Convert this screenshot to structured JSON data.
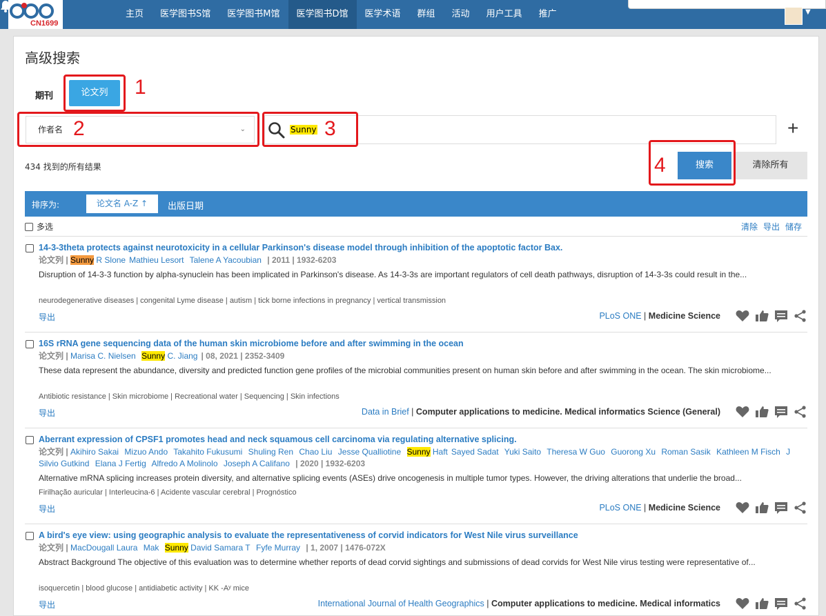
{
  "nav": {
    "logo_text": "CN1699",
    "menu": [
      "主页",
      "医学图书S馆",
      "医学图书M馆",
      "医学图书D馆",
      "医学术语",
      "群组",
      "活动",
      "用户工具",
      "推广"
    ],
    "active_index": 3
  },
  "page": {
    "title": "高级搜索",
    "tab_journal": "期刊",
    "tab_paper": "论文列",
    "field_select": "作者名",
    "query": "Sunny",
    "search_btn": "搜索",
    "clear_btn": "清除所有",
    "result_count": "434 找到的所有结果",
    "sort_label": "排序为:",
    "sort_title": "论文名 A-Z",
    "sort_date": "出版日期",
    "multi_select": "多选",
    "tools": {
      "clear": "清除",
      "export": "导出",
      "save": "储存"
    }
  },
  "annotations": [
    "1",
    "2",
    "3",
    "4"
  ],
  "results": [
    {
      "title": "14-3-3theta protects against neurotoxicity in a cellular Parkinson's disease model through inhibition of the apoptotic factor Bax.",
      "kind": "论文列",
      "hl_style": "orange",
      "authors_pre": [],
      "hl_name": "Sunny",
      "hl_suffix": "R Slone",
      "authors_post": [
        "Mathieu Lesort",
        "Talene A Yacoubian"
      ],
      "meta": "2011 | 1932-6203",
      "abstract": "Disruption of 14-3-3 function by alpha-synuclein has been implicated in Parkinson's disease. As 14-3-3s are important regulators of cell death pathways, disruption of 14-3-3s could result in the...",
      "keywords": "neurodegenerative diseases | congenital Lyme disease | autism | tick borne infections in pregnancy | vertical transmission",
      "export": "导出",
      "journal": "PLoS ONE",
      "categories": "Medicine  Science"
    },
    {
      "title": "16S rRNA gene sequencing data of the human skin microbiome before and after swimming in the ocean",
      "kind": "论文列",
      "hl_style": "yellow",
      "authors_pre": [
        "Marisa C. Nielsen"
      ],
      "hl_name": "Sunny",
      "hl_suffix": "C. Jiang",
      "authors_post": [],
      "meta": "08, 2021 | 2352-3409",
      "abstract": "These data represent the abundance, diversity and predicted function gene profiles of the microbial communities present on human skin before and after swimming in the ocean. The skin microbiome...",
      "keywords": "Antibiotic resistance | Skin microbiome | Recreational water | Sequencing | Skin infections",
      "export": "导出",
      "journal": "Data in Brief",
      "categories": "Computer applications to medicine. Medical informatics  Science (General)"
    },
    {
      "title": "Aberrant expression of CPSF1 promotes head and neck squamous cell carcinoma via regulating alternative splicing.",
      "kind": "论文列",
      "hl_style": "yellow",
      "authors_pre": [
        "Akihiro Sakai",
        "Mizuo Ando",
        "Takahito Fukusumi",
        "Shuling Ren",
        "Chao Liu",
        "Jesse Qualliotine"
      ],
      "hl_name": "Sunny",
      "hl_suffix": "Haft",
      "authors_post": [
        "Sayed Sadat",
        "Yuki Saito",
        "Theresa W Guo",
        "Guorong Xu",
        "Roman Sasik",
        "Kathleen M Fisch",
        "J Silvio Gutkind",
        "Elana J Fertig",
        "Alfredo A Molinolo",
        "Joseph A Califano"
      ],
      "meta": "2020 | 1932-6203",
      "abstract": "Alternative mRNA splicing increases protein diversity, and alternative splicing events (ASEs) drive oncogenesis in multiple tumor types. However, the driving alterations that underlie the broad...",
      "keywords": "Firilhação auricular | Interleucina-6 | Acidente vascular cerebral | Prognóstico",
      "export": "导出",
      "journal": "PLoS ONE",
      "categories": "Medicine  Science"
    },
    {
      "title": "A bird's eye view: using geographic analysis to evaluate the representativeness of corvid indicators for West Nile virus surveillance",
      "kind": "论文列",
      "hl_style": "yellow",
      "authors_pre": [
        "MacDougall Laura",
        "Mak"
      ],
      "hl_name": "Sunny",
      "hl_suffix": "",
      "authors_post": [
        "David Samara T",
        "Fyfe Murray"
      ],
      "meta": "1, 2007 | 1476-072X",
      "abstract": "Abstract Background The objective of this evaluation was to determine whether reports of dead corvid sightings and submissions of dead corvids for West Nile virus testing were representative of...",
      "keywords": "isoquercetin | blood glucose | antidiabetic activity | KK -Aʸ mice",
      "export": "导出",
      "journal": "International Journal of Health Geographics",
      "categories": "Computer applications to medicine. Medical informatics"
    }
  ]
}
